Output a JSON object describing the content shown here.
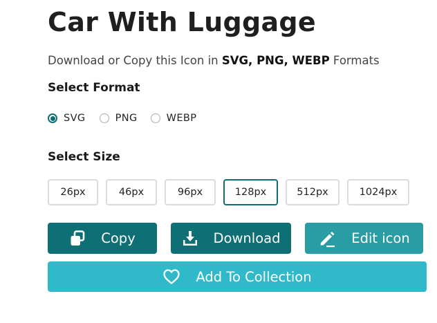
{
  "title": "Car With Luggage",
  "subtitle": {
    "prefix": "Download or Copy this Icon in ",
    "formats": "SVG, PNG, WEBP",
    "suffix": " Formats"
  },
  "format_section": {
    "label": "Select Format",
    "options": [
      "SVG",
      "PNG",
      "WEBP"
    ],
    "selected": "SVG"
  },
  "size_section": {
    "label": "Select Size",
    "options": [
      "26px",
      "46px",
      "96px",
      "128px",
      "512px",
      "1024px"
    ],
    "selected": "128px"
  },
  "actions": {
    "copy_label": "Copy",
    "download_label": "Download",
    "edit_label": "Edit icon",
    "collection_label": "Add To Collection"
  },
  "icons": {
    "copy": "copy-icon",
    "download": "download-icon",
    "edit": "pencil-icon",
    "collection": "heart-icon"
  },
  "colors": {
    "primary": "#0e6f74",
    "edit": "#2a9ca3",
    "collection": "#2fb9c9",
    "selected_border": "#0f6e73"
  }
}
